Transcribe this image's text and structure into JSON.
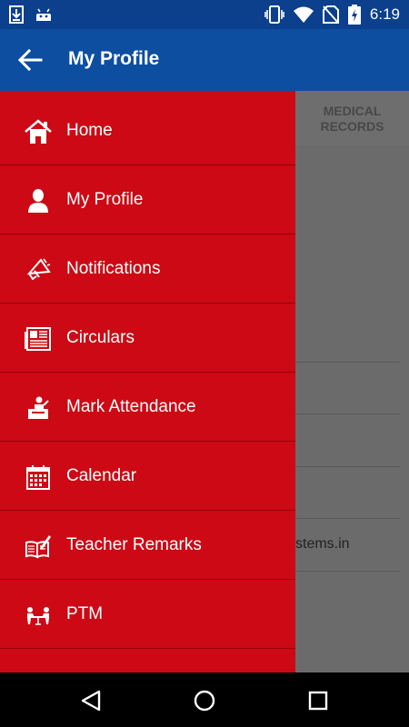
{
  "status_bar": {
    "time": "6:19",
    "left_icons": [
      "download-icon",
      "android-icon"
    ],
    "right_icons": [
      "vibrate-icon",
      "wifi-icon",
      "no-sim-icon",
      "battery-charging-icon"
    ]
  },
  "app_bar": {
    "title": "My Profile",
    "background": "#0d4ea1"
  },
  "background_content": {
    "tab_label": "MEDICAL RECORDS",
    "partial_text": "stems.in"
  },
  "drawer": {
    "background": "#cc0914",
    "items": [
      {
        "label": "Home",
        "icon": "home-icon"
      },
      {
        "label": "My Profile",
        "icon": "person-icon"
      },
      {
        "label": "Notifications",
        "icon": "megaphone-icon"
      },
      {
        "label": "Circulars",
        "icon": "newspaper-icon"
      },
      {
        "label": "Mark Attendance",
        "icon": "attendance-icon"
      },
      {
        "label": "Calendar",
        "icon": "calendar-icon"
      },
      {
        "label": "Teacher Remarks",
        "icon": "book-pen-icon"
      },
      {
        "label": "PTM",
        "icon": "meeting-icon"
      }
    ]
  },
  "nav_bar": {
    "buttons": [
      "back-triangle-icon",
      "home-circle-icon",
      "recents-square-icon"
    ]
  }
}
